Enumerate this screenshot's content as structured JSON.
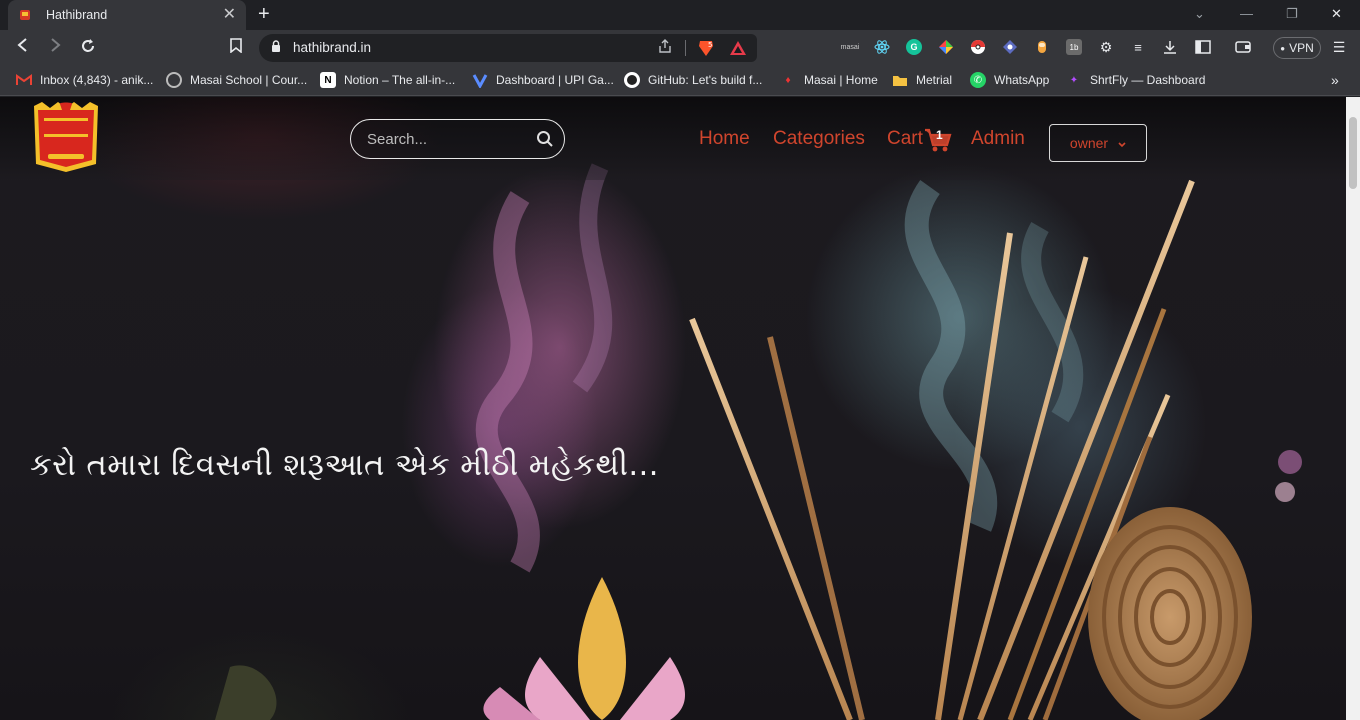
{
  "browser": {
    "tab_title": "Hathibrand",
    "url": "hathibrand.in",
    "vpn_label": "VPN",
    "bookmarks": [
      {
        "label": "Inbox (4,843) - anik...",
        "icon": "gmail-icon"
      },
      {
        "label": "Masai School | Cour...",
        "icon": "globe-icon"
      },
      {
        "label": "Notion – The all-in-...",
        "icon": "notion-icon"
      },
      {
        "label": "Dashboard | UPI Ga...",
        "icon": "upi-icon"
      },
      {
        "label": "GitHub: Let's build f...",
        "icon": "github-icon"
      },
      {
        "label": "Masai | Home",
        "icon": "masai-icon"
      },
      {
        "label": "Metrial",
        "icon": "folder-icon"
      },
      {
        "label": "WhatsApp",
        "icon": "whatsapp-icon"
      },
      {
        "label": "ShrtFly — Dashboard",
        "icon": "shrtfly-icon"
      }
    ],
    "brave_shield_count": "5"
  },
  "site": {
    "search_placeholder": "Search...",
    "nav": {
      "home": "Home",
      "categories": "Categories",
      "cart": "Cart",
      "cart_count": "1",
      "admin": "Admin",
      "user": "owner"
    },
    "hero_tagline": "કરો તમારા દિવસની શરૂઆત એક મીઠી મહેકથી...",
    "accent_color": "#d0452d"
  }
}
